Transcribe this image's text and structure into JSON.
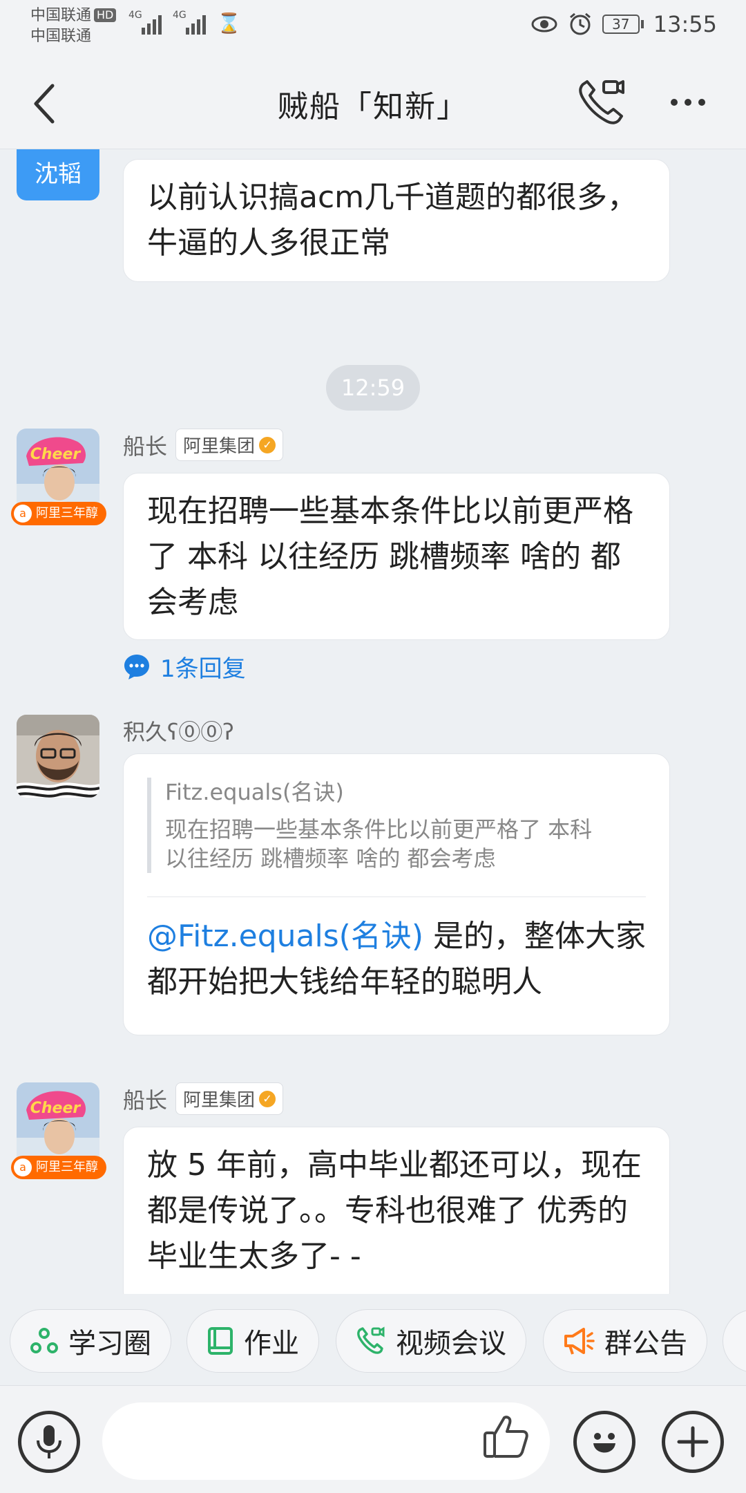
{
  "status_bar": {
    "carrier_1": "中国联通",
    "hd": "HD",
    "carrier_2": "中国联通",
    "signal_1_label": "4G",
    "signal_2_label": "4G",
    "battery": "37",
    "time": "13:55"
  },
  "header": {
    "title": "贼船「知新」"
  },
  "messages": {
    "m1": {
      "sender_avatar_text": "沈韬",
      "text": "以前认识搞acm几千道题的都很多，牛逼的人多很正常"
    },
    "time_divider": "12:59",
    "m2": {
      "sender": "船长",
      "org": "阿里集团",
      "badge": "阿里三年醇",
      "text": "现在招聘一些基本条件比以前更严格了  本科 以往经历 跳槽频率 啥的 都会考虑",
      "reply_count": "1条回复"
    },
    "m3": {
      "sender": "积久ʕ⓪⓪ʔ",
      "quote_name": "Fitz.equals(名诀)",
      "quote_text": "现在招聘一些基本条件比以前更严格了 本科 以往经历 跳槽频率 啥的 都会考虑",
      "mention": "@Fitz.equals(名诀)",
      "text": " 是的，整体大家都开始把大钱给年轻的聪明人"
    },
    "m4": {
      "sender": "船长",
      "org": "阿里集团",
      "badge": "阿里三年醇",
      "text": "放 5 年前，高中毕业都还可以，现在都是传说了。。专科也很难了 优秀的毕业生太多了- -"
    }
  },
  "shortcuts": [
    {
      "label": "学习圈",
      "icon": "circle-share-icon",
      "color": "#2DB36A"
    },
    {
      "label": "作业",
      "icon": "book-icon",
      "color": "#2DB36A"
    },
    {
      "label": "视频会议",
      "icon": "video-call-icon",
      "color": "#2DB36A"
    },
    {
      "label": "群公告",
      "icon": "megaphone-icon",
      "color": "#FF7A1A"
    }
  ],
  "input": {
    "placeholder": ""
  },
  "colors": {
    "link": "#1E7FE0",
    "badge": "#FF6A00",
    "avatar_blue": "#3D9BF5"
  }
}
